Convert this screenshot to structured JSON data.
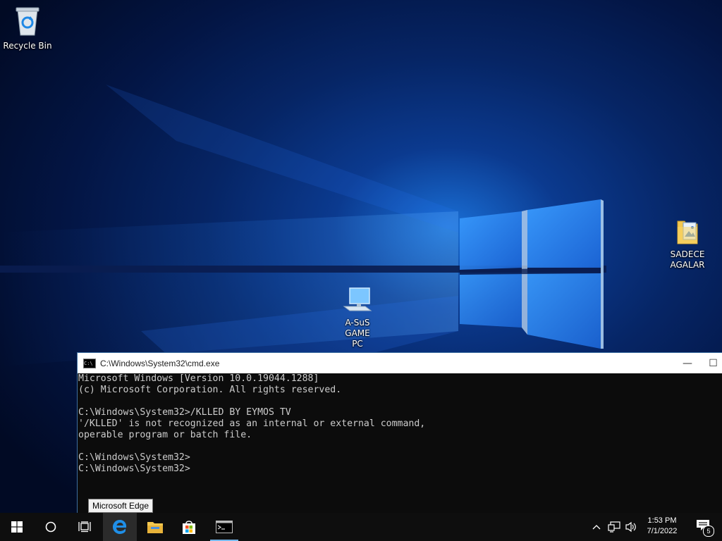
{
  "desktop": {
    "icons": [
      {
        "label": "Recycle Bin",
        "icon": "recycle-bin-icon"
      },
      {
        "label": "A-SuS GAME\nPC",
        "icon": "computer-icon"
      },
      {
        "label": "SADECE\nAGALAR",
        "icon": "folder-icon"
      }
    ]
  },
  "cmd_window": {
    "title": "C:\\Windows\\System32\\cmd.exe",
    "lines": [
      "Microsoft Windows [Version 10.0.19044.1288]",
      "(c) Microsoft Corporation. All rights reserved.",
      "",
      "C:\\Windows\\System32>/KLLED BY EYMOS TV",
      "'/KLLED' is not recognized as an internal or external command,",
      "operable program or batch file.",
      "",
      "C:\\Windows\\System32>",
      "C:\\Windows\\System32>"
    ],
    "minimize_glyph": "—",
    "maximize_glyph": "☐"
  },
  "tooltip": {
    "text": "Microsoft Edge"
  },
  "taskbar": {
    "items": [
      {
        "name": "start",
        "icon": "windows-logo-icon"
      },
      {
        "name": "cortana",
        "icon": "search-circle-icon"
      },
      {
        "name": "task-view",
        "icon": "task-view-icon"
      },
      {
        "name": "edge",
        "icon": "edge-icon"
      },
      {
        "name": "file-explorer",
        "icon": "folder-icon"
      },
      {
        "name": "store",
        "icon": "store-icon"
      },
      {
        "name": "cmd",
        "icon": "cmd-icon"
      }
    ],
    "tray": {
      "time": "1:53 PM",
      "date": "7/1/2022",
      "notification_count": "5"
    }
  },
  "colors": {
    "taskbar_bg": "#0e0e0e",
    "accent": "#76b9ed",
    "console_bg": "#0c0c0c",
    "console_fg": "#cccccc"
  }
}
